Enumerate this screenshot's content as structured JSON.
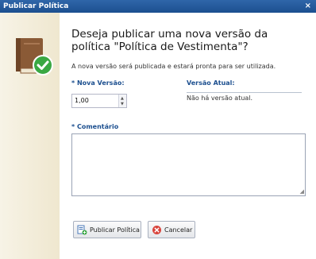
{
  "window": {
    "title": "Publicar Política",
    "close_glyph": "×"
  },
  "header": {
    "heading": "Deseja publicar uma nova versão da política \"Política de Vestimenta\"?",
    "subtext": "A nova versão será publicada e estará pronta para ser utilizada."
  },
  "form": {
    "nova_versao_label": "* Nova Versão:",
    "nova_versao_value": "1,00",
    "versao_atual_label": "Versão Atual:",
    "versao_atual_value": "Não há versão atual.",
    "comentario_label": "* Comentário",
    "comentario_value": ""
  },
  "buttons": {
    "publish": "Publicar Política",
    "cancel": "Cancelar"
  },
  "icons": {
    "side": "book-check-icon",
    "publish": "document-add-icon",
    "cancel": "cancel-icon",
    "spinner_up": "spinner-up-icon",
    "spinner_down": "spinner-down-icon"
  },
  "colors": {
    "titlebar": "#1c4f8f",
    "label_blue": "#1c4f8f",
    "book_brown": "#8a5a36",
    "check_green": "#3aa843",
    "cancel_red": "#d9453d"
  }
}
